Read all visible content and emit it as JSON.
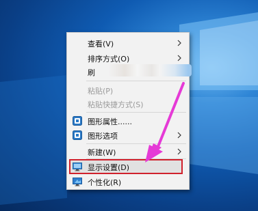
{
  "menu": {
    "items": [
      {
        "label": "查看(V)"
      },
      {
        "label": "排序方式(O)"
      },
      {
        "label": "刷新(E)"
      },
      {
        "label": "粘贴(P)"
      },
      {
        "label": "粘贴快捷方式(S)"
      },
      {
        "label": "图形属性......"
      },
      {
        "label": "图形选项"
      },
      {
        "label": "新建(W)"
      },
      {
        "label": "显示设置(D)"
      },
      {
        "label": "个性化(R)"
      }
    ],
    "refresh_visible": "刷"
  },
  "colors": {
    "highlight_border": "#d0202c",
    "annotation_arrow": "#e53ad6",
    "desktop_blue": "#0f5bb2"
  },
  "icons": [
    "intel-graphics-icon",
    "intel-graphics-icon",
    "display-icon",
    "personalize-icon"
  ]
}
